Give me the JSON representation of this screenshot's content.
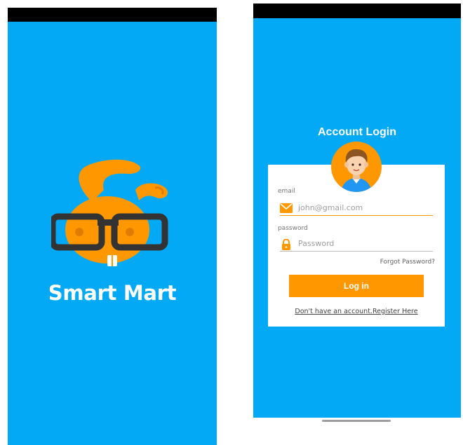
{
  "splash": {
    "brand_name": "Smart Mart",
    "logo_icon": "bunny-glasses-logo-icon",
    "background_color": "#03a9f4",
    "accent_color": "#ff9800"
  },
  "login": {
    "title": "Account Login",
    "avatar_icon": "user-avatar-icon",
    "email": {
      "label": "email",
      "placeholder": "john@gmail.com",
      "icon": "envelope-icon"
    },
    "password": {
      "label": "password",
      "placeholder": "Password",
      "icon": "lock-icon"
    },
    "forgot_password": "Forgot Password?",
    "login_button": "Log in",
    "register_link": "Don't have an account.Register Here",
    "button_color": "#ff9800"
  }
}
